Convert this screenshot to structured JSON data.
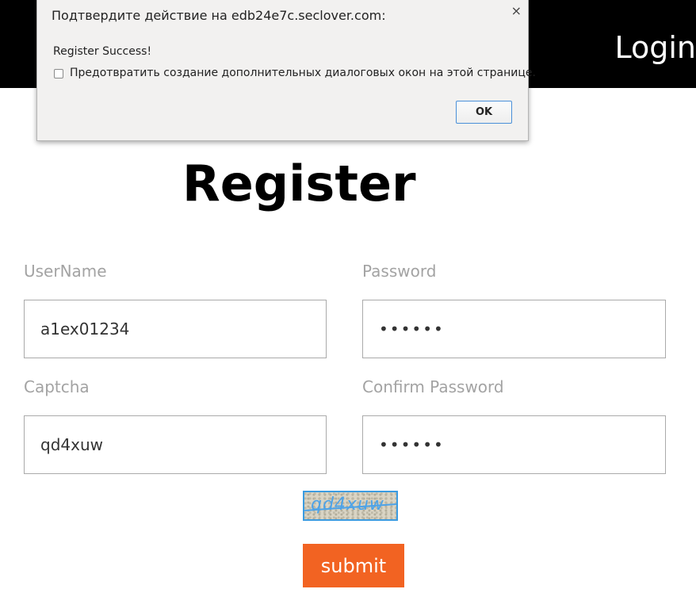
{
  "header": {
    "login_label": "Login"
  },
  "page": {
    "title": "Register"
  },
  "form": {
    "username": {
      "label": "UserName",
      "value": "a1ex01234"
    },
    "password": {
      "label": "Password",
      "value": "••••••"
    },
    "captcha": {
      "label": "Captcha",
      "value": "qd4xuw"
    },
    "confirm_password": {
      "label": "Confirm Password",
      "value": "••••••"
    },
    "captcha_image_text": "qd4xuw",
    "submit_label": "submit"
  },
  "dialog": {
    "title": "Подтвердите действие на edb24e7c.seclover.com:",
    "close_glyph": "×",
    "message": "Register Success!",
    "checkbox_label": "Предотвратить создание дополнительных диалоговых окон на этой странице.",
    "ok_label": "OK"
  },
  "colors": {
    "header_bg": "#000000",
    "submit_bg": "#f26322",
    "label_gray": "#a3a3a3",
    "captcha_blue": "#4da3e8"
  }
}
